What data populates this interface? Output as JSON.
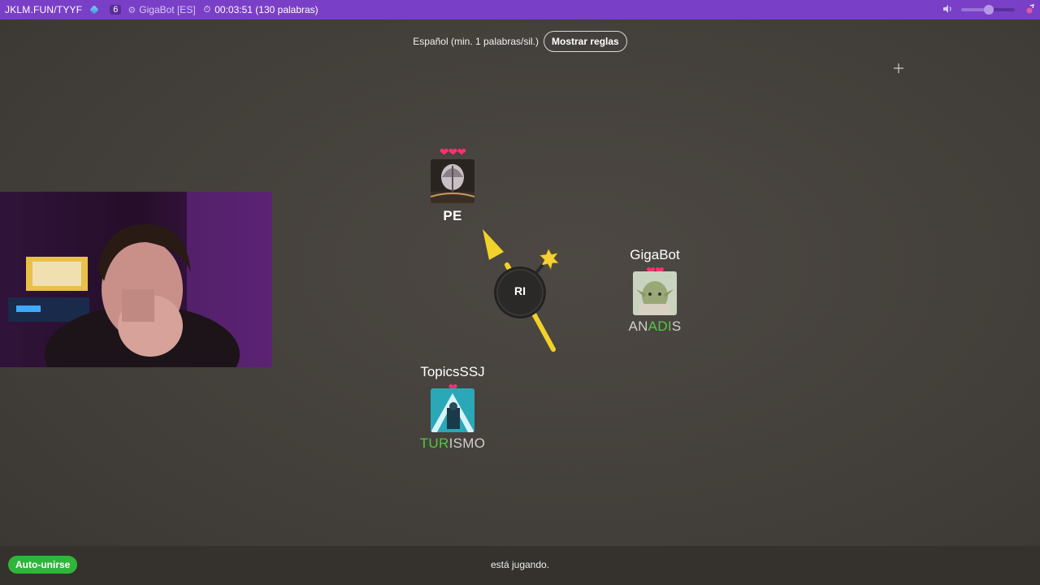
{
  "topbar": {
    "room": "JKLM.FUN/TYYF",
    "player_count": "6",
    "bot_name": "GigaBot [ES]",
    "timer": "00:03:51 (130 palabras)"
  },
  "rules": {
    "language": "Español (min. 1 palabras/sil.)",
    "show_rules_button": "Mostrar reglas"
  },
  "game": {
    "syllable": "RI",
    "players": [
      {
        "name": "",
        "hearts": "❤❤❤",
        "word_highlight": "",
        "word_rest": "PE",
        "avatar": "dark-flower-avatar"
      },
      {
        "name": "GigaBot",
        "hearts": "❤❤",
        "word_prefix": "AN",
        "word_highlight": "ADI",
        "word_suffix": "S",
        "avatar": "yoda-avatar"
      },
      {
        "name": "TopicsSSJ",
        "hearts": "❤",
        "word_highlight": "TUR",
        "word_rest": "ISMO",
        "avatar": "teal-avatar"
      }
    ]
  },
  "bottombar": {
    "auto_join": "Auto-unirse",
    "status": "está jugando."
  },
  "colors": {
    "topbar": "#7a3fc7",
    "highlight": "#4ecb3f",
    "heart": "#ff2f73",
    "arrow": "#f2d22a",
    "auto_join": "#2fb53a"
  }
}
